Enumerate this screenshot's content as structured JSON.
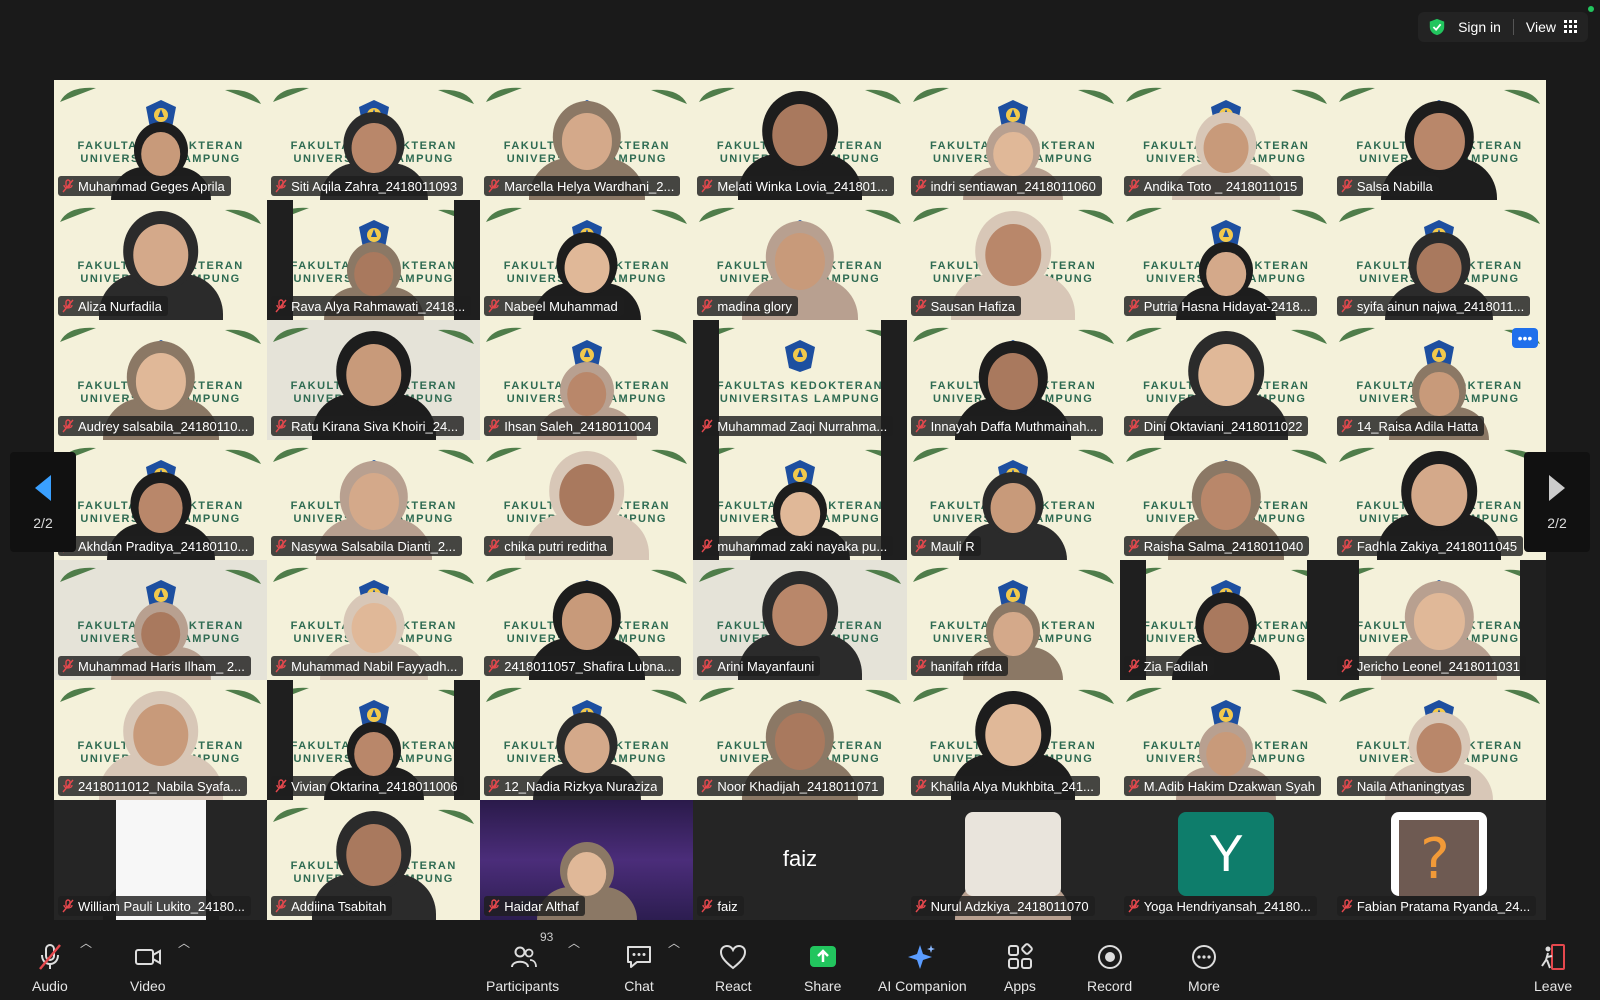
{
  "topbar": {
    "sign_in": "Sign in",
    "view": "View"
  },
  "pagination": {
    "left_label": "2/2",
    "right_label": "2/2"
  },
  "participants": [
    {
      "name": "Muhammad Geges Aprila"
    },
    {
      "name": "Siti Aqila Zahra_2418011093"
    },
    {
      "name": "Marcella Helya Wardhani_2..."
    },
    {
      "name": "Melati Winka Lovia_241801..."
    },
    {
      "name": "indri sentiawan_2418011060"
    },
    {
      "name": "Andika Toto _ 2418011015"
    },
    {
      "name": "Salsa Nabilla"
    },
    {
      "name": "Aliza Nurfadila"
    },
    {
      "name": "Rava Alya Rahmawati_2418..."
    },
    {
      "name": "Nabeel Muhammad"
    },
    {
      "name": "madina glory"
    },
    {
      "name": "Sausan Hafiza"
    },
    {
      "name": "Putria Hasna Hidayat-2418..."
    },
    {
      "name": "syifa ainun najwa_2418011..."
    },
    {
      "name": "Audrey salsabila_24180110..."
    },
    {
      "name": "Ratu Kirana Siva Khoiri_24..."
    },
    {
      "name": "Ihsan Saleh_2418011004"
    },
    {
      "name": "Muhammad Zaqi Nurrahma..."
    },
    {
      "name": "Innayah Daffa Muthmainah..."
    },
    {
      "name": "Dini Oktaviani_2418011022"
    },
    {
      "name": "14_Raisa Adila Hatta"
    },
    {
      "name": "Akhdan Praditya_24180110..."
    },
    {
      "name": "Nasywa Salsabila Dianti_2..."
    },
    {
      "name": "chika putri reditha"
    },
    {
      "name": "muhammad zaki nayaka pu..."
    },
    {
      "name": "Mauli R"
    },
    {
      "name": "Raisha Salma_2418011040"
    },
    {
      "name": "Fadhla Zakiya_2418011045"
    },
    {
      "name": "Muhammad Haris Ilham_ 2..."
    },
    {
      "name": "Muhammad Nabil Fayyadh..."
    },
    {
      "name": "2418011057_Shafira Lubna..."
    },
    {
      "name": "Arini Mayanfauni"
    },
    {
      "name": "hanifah rifda"
    },
    {
      "name": "Zia Fadilah"
    },
    {
      "name": "Jericho Leonel_2418011031"
    },
    {
      "name": "2418011012_Nabila Syafa..."
    },
    {
      "name": "Vivian Oktarina_2418011006"
    },
    {
      "name": "12_Nadia Rizkya Nuraziza"
    },
    {
      "name": "Noor Khadijah_2418011071"
    },
    {
      "name": "Khalila Alya Mukhbita_241..."
    },
    {
      "name": "M.Adib Hakim Dzakwan Syah"
    },
    {
      "name": "Naila Athaningtyas"
    },
    {
      "name": "William Pauli Lukito_24180..."
    },
    {
      "name": "Addiina Tsabitah"
    },
    {
      "name": "Haidar Althaf"
    },
    {
      "name": "faiz"
    },
    {
      "name": "Nurul Adzkiya_2418011070"
    },
    {
      "name": "Yoga Hendriyansah_24180..."
    },
    {
      "name": "Fabian Pratama Ryanda_24..."
    }
  ],
  "background_text": {
    "line1": "FAKULTAS KEDOKTERAN",
    "line2": "UNIVERSITAS LAMPUNG"
  },
  "faiz_tile_text": "faiz",
  "yoga_initial": "Y",
  "toolbar": {
    "audio": "Audio",
    "video": "Video",
    "participants": "Participants",
    "participants_count": "93",
    "chat": "Chat",
    "react": "React",
    "share": "Share",
    "ai_companion": "AI Companion",
    "apps": "Apps",
    "record": "Record",
    "more": "More",
    "leave": "Leave"
  },
  "colors": {
    "share_green": "#22c55e",
    "mute_red": "#e5484d",
    "accent_blue": "#1f6feb"
  }
}
